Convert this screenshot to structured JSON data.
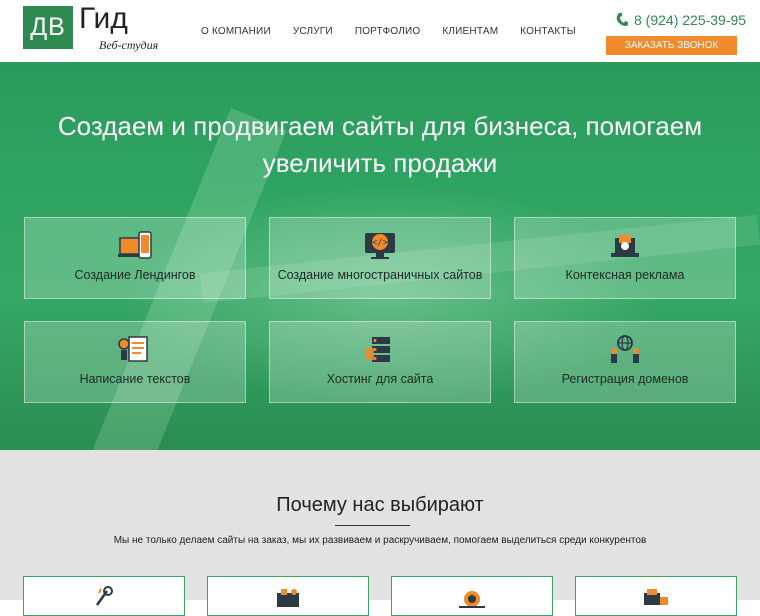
{
  "header": {
    "logo_box": "ДВ",
    "logo_word": "Гид",
    "logo_sub": "Веб-студия",
    "nav": [
      "О КОМПАНИИ",
      "УСЛУГИ",
      "ПОРТФОЛИО",
      "КЛИЕНТАМ",
      "КОНТАКТЫ"
    ],
    "phone": "8 (924) 225-39-95",
    "callback_label": "ЗАКАЗАТЬ ЗВОНОК"
  },
  "hero": {
    "title": "Создаем и продвигаем сайты для бизнеса, помогаем увеличить продажи",
    "services": [
      {
        "label": "Создание Лендингов",
        "icon": "devices-icon"
      },
      {
        "label": "Создание многостраничных сайтов",
        "icon": "code-monitor-icon"
      },
      {
        "label": "Контексная реклама",
        "icon": "laptop-ads-icon"
      },
      {
        "label": "Написание текстов",
        "icon": "copywriting-icon"
      },
      {
        "label": "Хостинг для сайта",
        "icon": "server-icon"
      },
      {
        "label": "Регистрация доменов",
        "icon": "globe-people-icon"
      }
    ]
  },
  "why": {
    "title": "Почему нас выбирают",
    "subtitle": "Мы не только делаем сайты на заказ, мы их развиваем и раскручиваем, помогаем выделиться среди конкурентов"
  },
  "colors": {
    "brand_green": "#2f8a52",
    "accent_orange": "#f08a2c",
    "icon_dark": "#2b3a44"
  }
}
